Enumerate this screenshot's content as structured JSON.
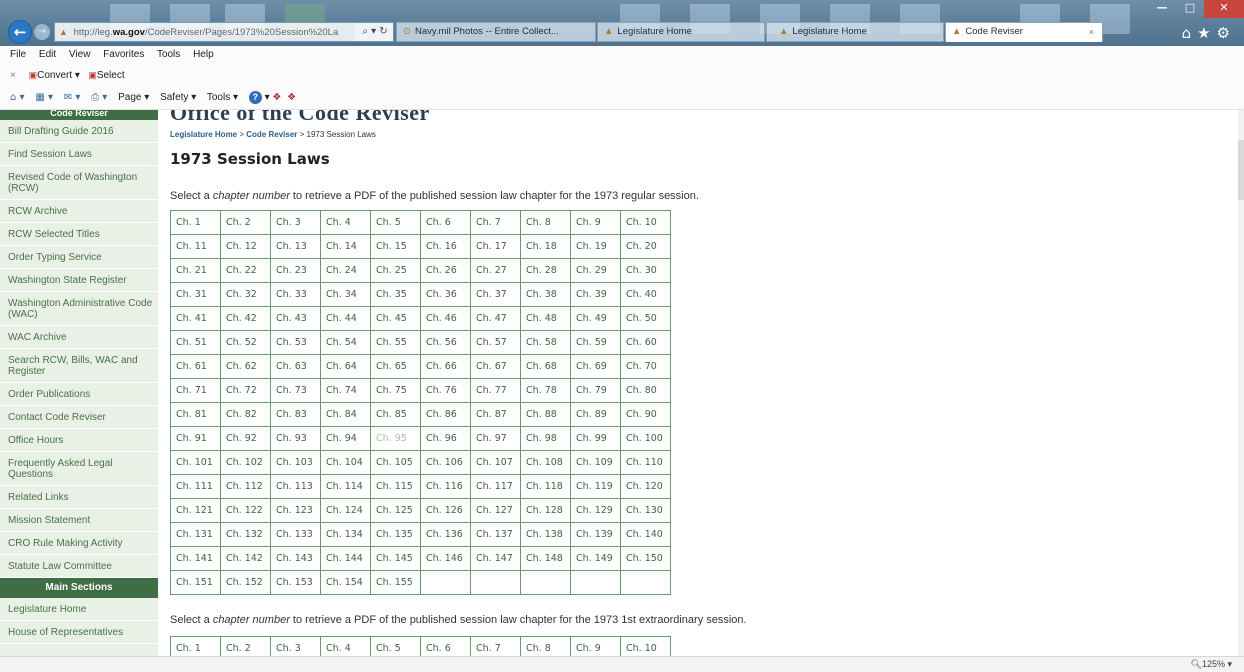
{
  "browser": {
    "url_prefix": "http://leg.",
    "url_domain": "wa.gov",
    "url_suffix": "/CodeReviser/Pages/1973%20Session%20La",
    "addr_controls": "⌕ ▾ ↻",
    "tabs": [
      {
        "label": "Navy.mil Photos -- Entire Collect...",
        "active": false
      },
      {
        "label": "Legislature Home",
        "active": false
      },
      {
        "label": "Legislature Home",
        "active": false
      },
      {
        "label": "Code Reviser",
        "active": true
      }
    ],
    "tab_close": "×",
    "menu": [
      "File",
      "Edit",
      "View",
      "Favorites",
      "Tools",
      "Help"
    ],
    "convert_label": "Convert",
    "select_label": "Select",
    "command": [
      "Page",
      "Safety",
      "Tools"
    ],
    "zoom": "125%"
  },
  "sidebar": {
    "top_header": "Code Reviser",
    "items": [
      "Bill Drafting Guide 2016",
      "Find Session Laws",
      "Revised Code of Washington (RCW)",
      "RCW Archive",
      "RCW Selected Titles",
      "Order Typing Service",
      "Washington State Register",
      "Washington Administrative Code (WAC)",
      "WAC Archive",
      "Search RCW, Bills, WAC and Register",
      "Order Publications",
      "Contact Code Reviser",
      "Office Hours",
      "Frequently Asked Legal Questions",
      "Related Links",
      "Mission Statement",
      "CRO Rule Making Activity",
      "Statute Law Committee"
    ],
    "main_sections_header": "Main Sections",
    "main_sections": [
      "Legislature Home",
      "House of Representatives"
    ]
  },
  "main": {
    "office_title": "Office of the Code Reviser",
    "breadcrumb": [
      "Legislature Home",
      "Code Reviser",
      "1973 Session Laws"
    ],
    "breadcrumb_sep": " > ",
    "page_title": "1973 Session Laws",
    "instruction_1": {
      "prefix": "Select a ",
      "em": "chapter number",
      "suffix": " to retrieve a PDF of the published session law chapter for the 1973 regular session."
    },
    "instruction_2": {
      "prefix": "Select a ",
      "em": "chapter number",
      "suffix": " to retrieve a PDF of the published session law chapter for the 1973 1st extraordinary session."
    },
    "chapter_prefix": "Ch. ",
    "regular_session": {
      "count": 155,
      "disabled": [
        95
      ]
    },
    "extraordinary_session": {
      "visible_count": 10
    }
  }
}
